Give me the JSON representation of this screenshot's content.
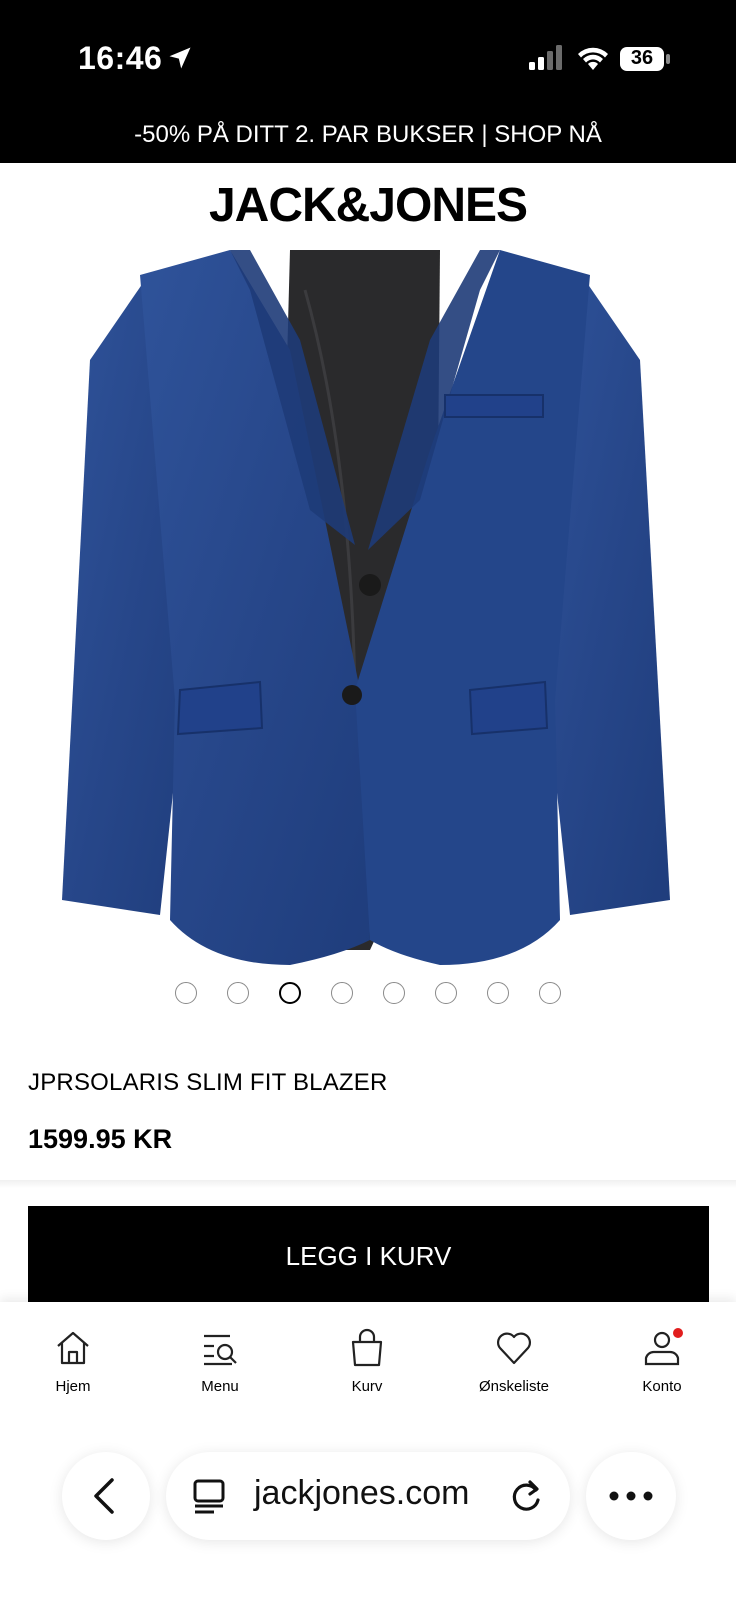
{
  "status_bar": {
    "time": "16:46",
    "battery": "36",
    "icons": [
      "location-arrow-icon",
      "cellular-signal-icon",
      "wifi-icon",
      "battery-icon"
    ]
  },
  "promo": {
    "text": "-50% PÅ DITT 2. PAR BUKSER | SHOP NÅ"
  },
  "header": {
    "logo": "JACK&JONES"
  },
  "product": {
    "title": "JPRSOLARIS SLIM FIT BLAZER",
    "price": "1599.95 KR",
    "color": "#2a4c8c",
    "image_count": 8,
    "active_image_index": 3
  },
  "cta": {
    "add_to_cart_label": "LEGG I KURV"
  },
  "bottom_nav": {
    "items": [
      {
        "label": "Hjem",
        "icon": "home-icon"
      },
      {
        "label": "Menu",
        "icon": "menu-search-icon"
      },
      {
        "label": "Kurv",
        "icon": "shopping-bag-icon"
      },
      {
        "label": "Ønskeliste",
        "icon": "heart-icon"
      },
      {
        "label": "Konto",
        "icon": "user-icon"
      }
    ],
    "notification_color": "#e11d1d"
  },
  "browser": {
    "url": "jackjones.com",
    "icons": [
      "back-chevron-icon",
      "reader-mode-icon",
      "reload-icon",
      "more-icon"
    ]
  }
}
